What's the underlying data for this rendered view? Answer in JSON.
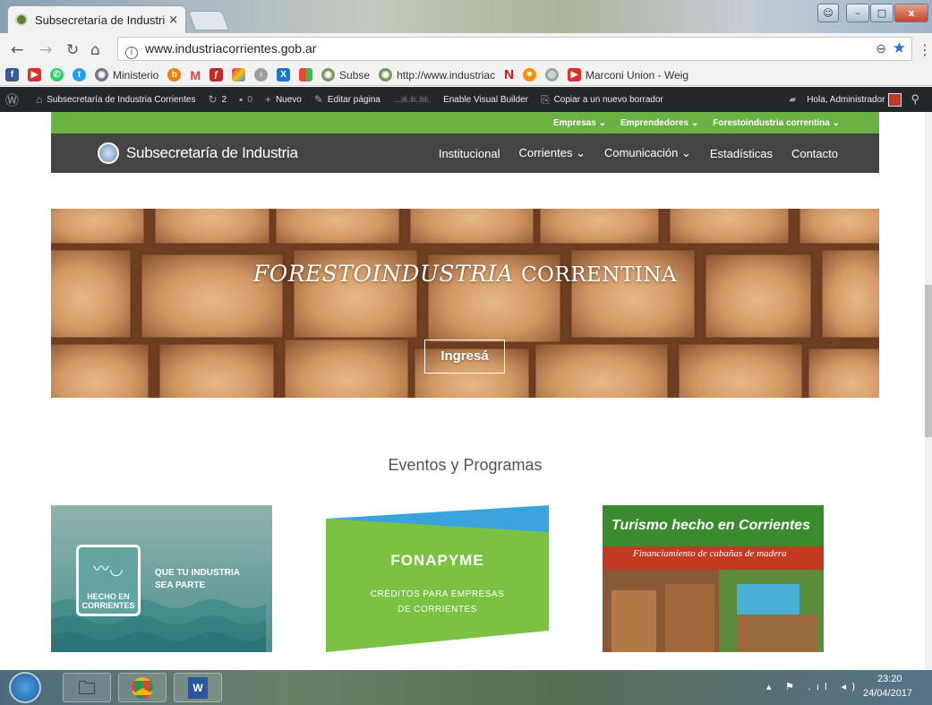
{
  "browser": {
    "tab_title": "Subsecretaría de Industri",
    "tab_close": "×",
    "url": "www.industriacorrientes.gob.ar",
    "bookmarks": [
      "Ministerio",
      "M",
      "Subse",
      "http://www.industriac",
      "Marconi Union - Weig"
    ]
  },
  "wp_admin": {
    "site": "Subsecretaría de Industria Corrientes",
    "updates": "2",
    "comments": "0",
    "new": "Nuevo",
    "edit": "Editar página",
    "visual_builder": "Enable Visual Builder",
    "copy_draft": "Copiar a un nuevo borrador",
    "greeting": "Hola, Administrador"
  },
  "site": {
    "top_nav": [
      "Empresas ⌄",
      "Emprendedores ⌄",
      "Forestoindustria correntina ⌄"
    ],
    "name": "Subsecretaría de Industria",
    "menu": [
      "Institucional",
      "Corrientes ⌄",
      "Comunicación ⌄",
      "Estadísticas",
      "Contacto"
    ]
  },
  "hero": {
    "title_main": "FORESTOINDUSTRIA",
    "title_rest": "CORRENTINA",
    "button": "Ingresá"
  },
  "events": {
    "title": "Eventos y Programas",
    "card1": {
      "line1": "QUE TU INDUSTRIA",
      "line2": "SEA PARTE",
      "badge1": "HECHO EN",
      "badge2": "CORRIENTES"
    },
    "card2": {
      "title": "FONAPYME",
      "sub1": "CRÉDITOS PARA EMPRESAS",
      "sub2": "DE CORRIENTES"
    },
    "card3": {
      "title": "Turismo hecho en Corrientes",
      "sub": "Financiamiento de cabañas de madera"
    }
  },
  "taskbar": {
    "time": "23:20",
    "date": "24/04/2017"
  },
  "colors": {
    "green": "#6bb244",
    "dark": "#444444",
    "admin": "#23282d"
  }
}
